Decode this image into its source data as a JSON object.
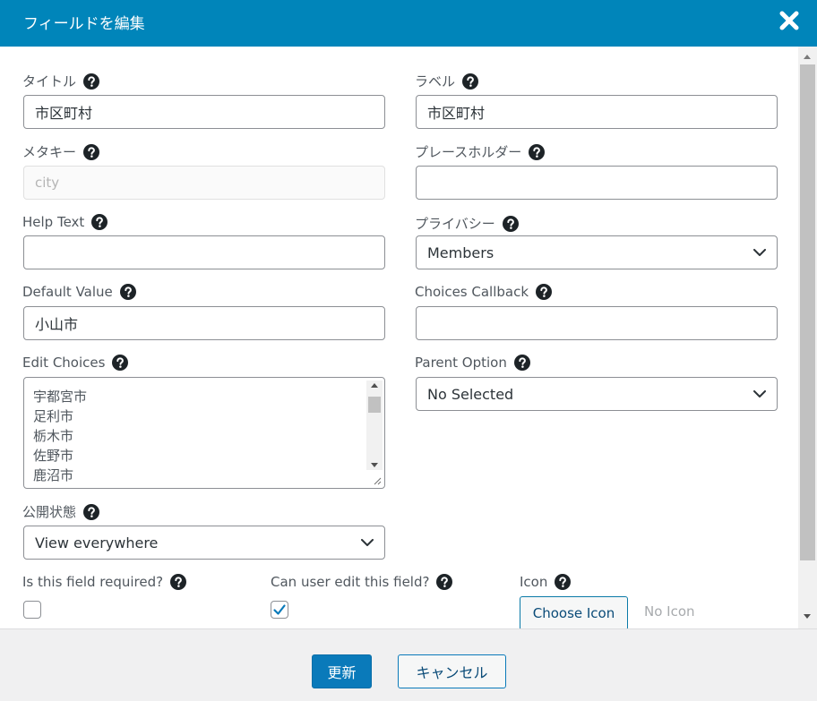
{
  "header": {
    "title": "フィールドを編集"
  },
  "fields": {
    "title": {
      "label": "タイトル",
      "value": "市区町村"
    },
    "label": {
      "label": "ラベル",
      "value": "市区町村"
    },
    "meta_key": {
      "label": "メタキー",
      "placeholder": "city"
    },
    "placeholder": {
      "label": "プレースホルダー",
      "value": ""
    },
    "help_text": {
      "label": "Help Text",
      "value": ""
    },
    "privacy": {
      "label": "プライバシー",
      "selected": "Members"
    },
    "default_value": {
      "label": "Default Value",
      "value": "小山市"
    },
    "choices_callback": {
      "label": "Choices Callback",
      "value": ""
    },
    "edit_choices": {
      "label": "Edit Choices",
      "items": [
        "宇都宮市",
        "足利市",
        "栃木市",
        "佐野市",
        "鹿沼市"
      ]
    },
    "parent_option": {
      "label": "Parent Option",
      "selected": "No Selected"
    },
    "visibility": {
      "label": "公開状態",
      "selected": "View everywhere"
    },
    "required": {
      "label": "Is this field required?",
      "checked": false
    },
    "editable": {
      "label": "Can user edit this field?",
      "checked": true
    },
    "icon": {
      "label": "Icon",
      "button": "Choose Icon",
      "status": "No Icon"
    }
  },
  "footer": {
    "update": "更新",
    "cancel": "キャンセル"
  },
  "colors": {
    "header": "#0085ba",
    "primary": "#0a7aba",
    "footer": "#f0f0f1"
  }
}
